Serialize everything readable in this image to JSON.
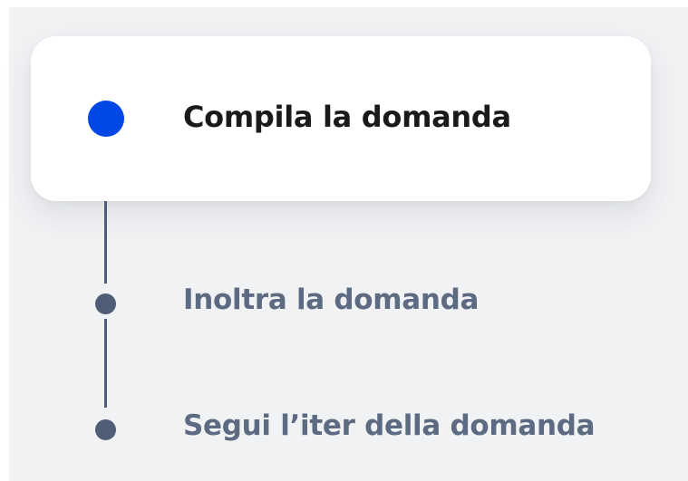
{
  "steps": [
    {
      "label": "Compila la domanda",
      "state": "active",
      "icon": "step-dot-active-icon"
    },
    {
      "label": "Inoltra la domanda",
      "state": "inactive",
      "icon": "step-dot-icon"
    },
    {
      "label": "Segui l’iter della domanda",
      "state": "inactive",
      "icon": "step-dot-icon"
    }
  ],
  "colors": {
    "active_dot": "#0047e6",
    "active_text": "#1a1a1a",
    "inactive_text": "#5c6a82",
    "connector": "#4f5e76",
    "panel_background": "#f1f2f4",
    "card_background": "#ffffff"
  }
}
